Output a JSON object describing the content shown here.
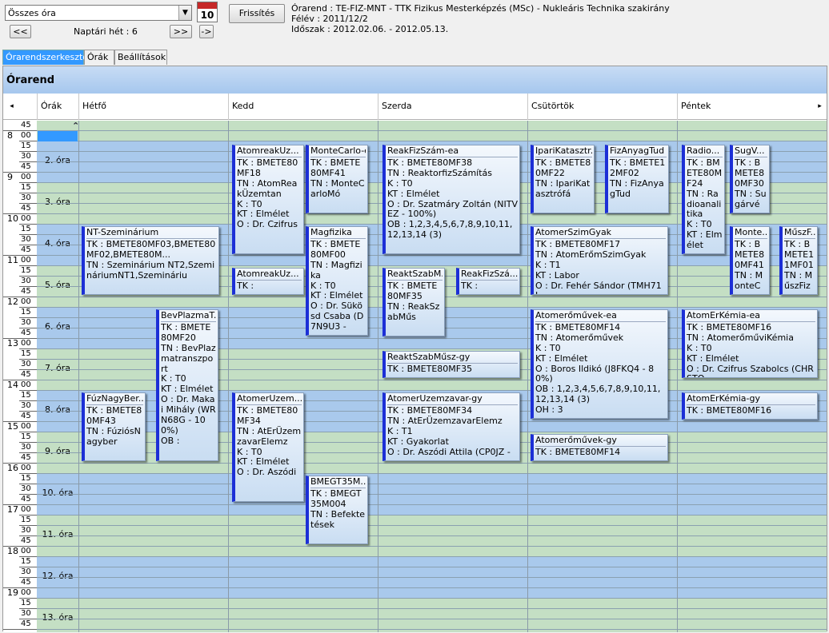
{
  "toolbar": {
    "combo_value": "Összes óra",
    "calendar_day": "10",
    "refresh": "Frissítés",
    "prev": "<<",
    "next": ">>",
    "last": "->",
    "week_label": "Naptári hét : 6"
  },
  "info": {
    "line1": "Órarend : TE-FIZ-MNT - TTK Fizikus Mesterképzés (MSc) - Nukleáris Technika szakirány",
    "line2": "Félév : 2011/12/2",
    "line3": "Időszak : 2012.02.06. - 2012.05.13."
  },
  "tabs": [
    "Órarendszerkesztő",
    "Órák",
    "Beállítások"
  ],
  "panel_title": "Órarend",
  "headers": {
    "left": "◂",
    "orak": "Órák",
    "days": [
      "Hétfő",
      "Kedd",
      "Szerda",
      "Csütörtök",
      "Péntek"
    ],
    "right": "▸"
  },
  "time_labels": [
    [
      "",
      "45"
    ],
    [
      "8",
      "00"
    ],
    [
      "",
      "15"
    ],
    [
      "",
      "30"
    ],
    [
      "",
      "45"
    ],
    [
      "9",
      "00"
    ],
    [
      "",
      "15"
    ],
    [
      "",
      "30"
    ],
    [
      "",
      "45"
    ],
    [
      "10",
      "00"
    ],
    [
      "",
      "15"
    ],
    [
      "",
      "30"
    ],
    [
      "",
      "45"
    ],
    [
      "11",
      "00"
    ],
    [
      "",
      "15"
    ],
    [
      "",
      "30"
    ],
    [
      "",
      "45"
    ],
    [
      "12",
      "00"
    ],
    [
      "",
      "15"
    ],
    [
      "",
      "30"
    ],
    [
      "",
      "45"
    ],
    [
      "13",
      "00"
    ],
    [
      "",
      "15"
    ],
    [
      "",
      "30"
    ],
    [
      "",
      "45"
    ],
    [
      "14",
      "00"
    ],
    [
      "",
      "15"
    ],
    [
      "",
      "30"
    ],
    [
      "",
      "45"
    ],
    [
      "15",
      "00"
    ],
    [
      "",
      "15"
    ],
    [
      "",
      "30"
    ],
    [
      "",
      "45"
    ],
    [
      "16",
      "00"
    ],
    [
      "",
      "15"
    ],
    [
      "",
      "30"
    ],
    [
      "",
      "45"
    ],
    [
      "17",
      "00"
    ],
    [
      "",
      "15"
    ],
    [
      "",
      "30"
    ],
    [
      "",
      "45"
    ],
    [
      "18",
      "00"
    ],
    [
      "",
      "15"
    ],
    [
      "",
      "30"
    ],
    [
      "",
      "45"
    ],
    [
      "19",
      "00"
    ],
    [
      "",
      "15"
    ],
    [
      "",
      "30"
    ],
    [
      "",
      "45"
    ]
  ],
  "ora_labels": [
    "2. óra",
    "3. óra",
    "4. óra",
    "5. óra",
    "6. óra",
    "7. óra",
    "8. óra",
    "9. óra",
    "10. óra",
    "11. óra",
    "12. óra",
    "13. óra"
  ],
  "events": [
    {
      "day": "kedd",
      "title": "AtomreakÜz...",
      "body": "TK : BMETE80MF18\nTN : AtomReakÜzemtan\nK : T0\nKT : Elmélet\nO : Dr. Czifrus"
    },
    {
      "day": "kedd",
      "title": "MonteCarlo-ea",
      "body": "TK : BMETE80MF41\nTN : MonteCarloMó"
    },
    {
      "day": "szerda",
      "title": "ReakFizSzám-ea",
      "body": "TK : BMETE80MF38\nTN : ReaktorfizSzámítás\nK : T0\nKT : Elmélet\nO : Dr. Szatmáry Zoltán (NITVEZ - 100%)\nOB : 1,2,3,4,5,6,7,8,9,10,11,12,13,14 (3)"
    },
    {
      "day": "csutortok",
      "title": "IpariKatasztr...",
      "body": "TK : BMETE80MF22\nTN : IpariKatasztrófá"
    },
    {
      "day": "csutortok",
      "title": "FizAnyagTud",
      "body": "TK : BMETE12MF02\nTN : FizAnyagTud"
    },
    {
      "day": "pentek",
      "title": "Radio...",
      "body": "TK : BMETE80MF24\nTN : Radioanalitika\nK : T0\nKT : Elmélet"
    },
    {
      "day": "pentek",
      "title": "SugV...",
      "body": "TK : BMETE80MF30\nTN : Sugárvé"
    },
    {
      "day": "hetfo",
      "title": "NT-Szeminárium",
      "body": "TK : BMETE80MF03,BMETE80MF02,BMETE80M...\nTN : Szeminárium NT2,SzemináriumNT1,Szemináriu"
    },
    {
      "day": "kedd",
      "title": "Magfizika",
      "body": "TK : BMETE80MF00\nTN : Magfizika\nK : T0\nKT : Elmélet\nO : Dr. Sükösd Csaba (D7N9U3 -"
    },
    {
      "day": "csutortok",
      "title": "AtomerSzimGyak",
      "body": "TK : BMETE80MF17\nTN : AtomErőmSzimGyak\nK : T1\nKT : Labor\nO : Dr. Fehér Sándor (TMH71L -"
    },
    {
      "day": "pentek",
      "title": "Monte...",
      "body": "TK : BMETE80MF41\nTN : MonteC"
    },
    {
      "day": "pentek",
      "title": "MűszF...",
      "body": "TK : BMETE11MF01\nTN : MűszFiz"
    },
    {
      "day": "kedd",
      "title": "AtomreakÜz...",
      "body": "TK :"
    },
    {
      "day": "szerda",
      "title": "ReaktSzabM...",
      "body": "TK : BMETE80MF35\nTN : ReakSzabMűs"
    },
    {
      "day": "szerda",
      "title": "ReakFizSzá...",
      "body": "TK :"
    },
    {
      "day": "hetfo",
      "title": "BevPlazmaT...",
      "body": "TK : BMETE80MF20\nTN : BevPlazmatranszport\nK : T0\nKT : Elmélet\nO : Dr. Makai Mihály (WRN68G - 100%)\nOB :"
    },
    {
      "day": "csutortok",
      "title": "Atomerőművek-ea",
      "body": "TK : BMETE80MF14\nTN : Atomerőművek\nK : T0\nKT : Elmélet\nO : Boros Ildikó (J8FKQ4 - 80%)\nOB : 1,2,3,4,5,6,7,8,9,10,11,12,13,14 (3)\nOH : 3"
    },
    {
      "day": "pentek",
      "title": "AtomErKémia-ea",
      "body": "TK : BMETE80MF16\nTN : AtomerőműviKémia\nK : T0\nKT : Elmélet\nO : Dr. Czifrus Szabolcs (CHRSTQ"
    },
    {
      "day": "szerda",
      "title": "ReaktSzabMűsz-gy",
      "body": "TK : BMETE80MF35"
    },
    {
      "day": "hetfo",
      "title": "FúzNagyBer...",
      "body": "TK : BMETE80MF43\nTN : FúziósNagyber"
    },
    {
      "day": "kedd",
      "title": "AtomerÜzem...",
      "body": "TK : BMETE80MF34\nTN : AtErÜzemzavarElemz\nK : T0\nKT : Elmélet\nO : Dr. Aszódi"
    },
    {
      "day": "szerda",
      "title": "AtomerÜzemzavar-gy",
      "body": "TK : BMETE80MF34\nTN : AtErÜzemzavarElemz\nK : T1\nKT : Gyakorlat\nO : Dr. Aszódi Attila (CP0JZ -"
    },
    {
      "day": "pentek",
      "title": "AtomErKémia-gy",
      "body": "TK : BMETE80MF16"
    },
    {
      "day": "csutortok",
      "title": "Atomerőművek-gy",
      "body": "TK : BMETE80MF14"
    },
    {
      "day": "kedd",
      "title": "BMEGT35M...",
      "body": "TK : BMEGT35M004\nTN : Befektetések"
    }
  ]
}
